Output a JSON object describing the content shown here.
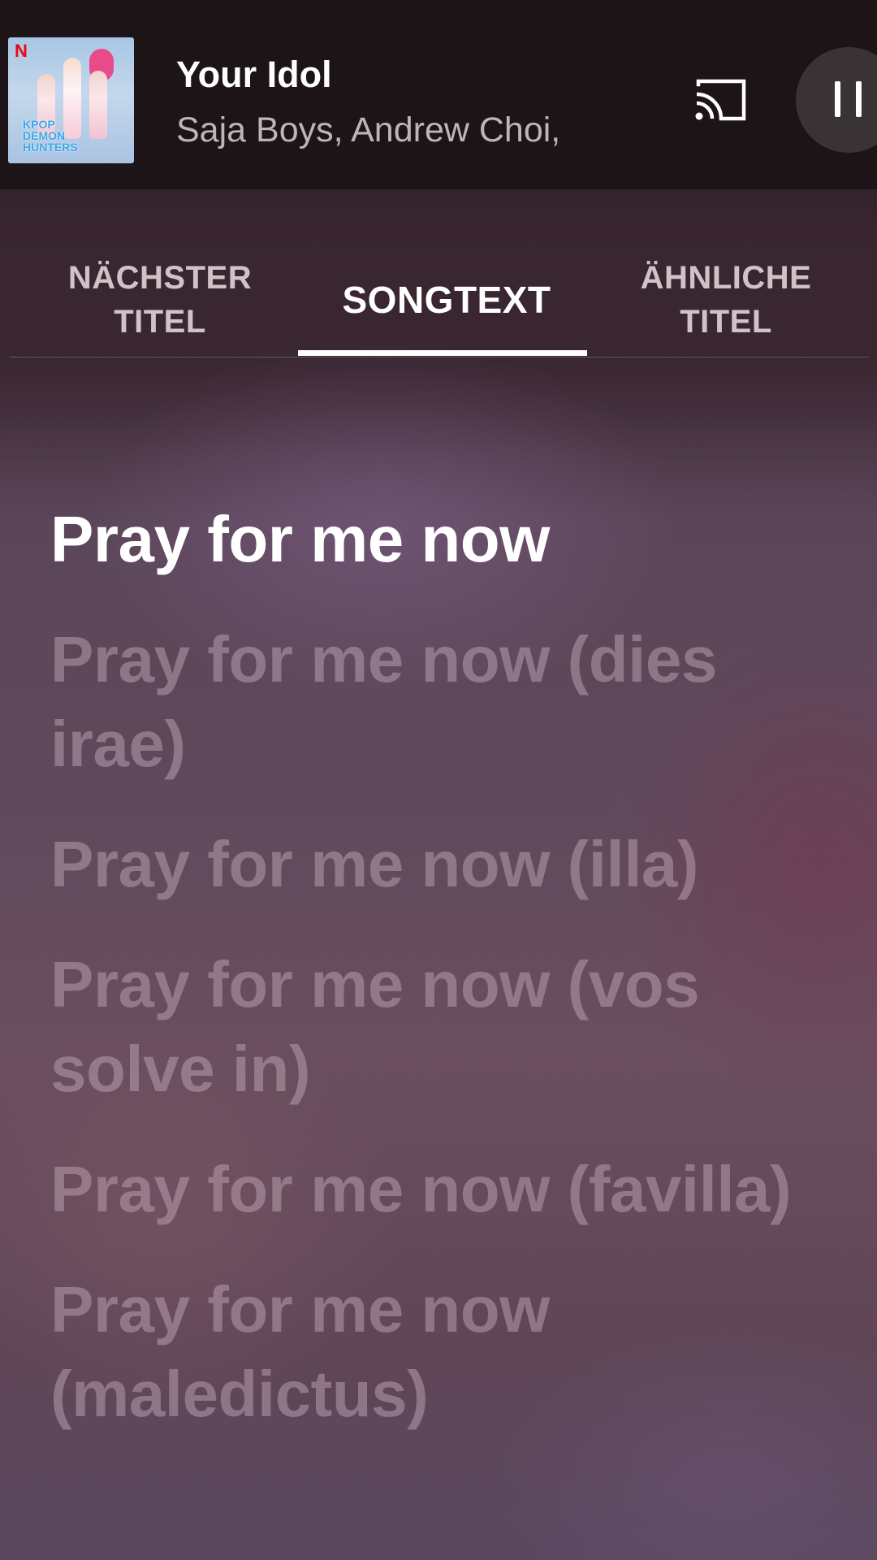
{
  "player": {
    "title": "Your Idol",
    "artist": "Saja Boys, Andrew Choi,",
    "album_art_brand": "N",
    "album_art_logo": "KPOP DEMON HUNTERS",
    "cast_icon": "cast-icon",
    "pause_icon": "pause-icon"
  },
  "tabs": [
    {
      "label": "NÄCHSTER TITEL",
      "selected": false
    },
    {
      "label": "SONGTEXT",
      "selected": true
    },
    {
      "label": "ÄHNLICHE TITEL",
      "selected": false
    }
  ],
  "lyrics": {
    "current": "Pray for me now",
    "upcoming": [
      "Pray for me now (dies irae)",
      "Pray for me now (illa)",
      "Pray for me now (vos solve in)",
      "Pray for me now (favilla)",
      "Pray for me now (maledictus)"
    ]
  },
  "colors": {
    "player_bg": "#1d1417",
    "accent": "#ffffff",
    "inactive_lyric": "#bea5b4"
  }
}
